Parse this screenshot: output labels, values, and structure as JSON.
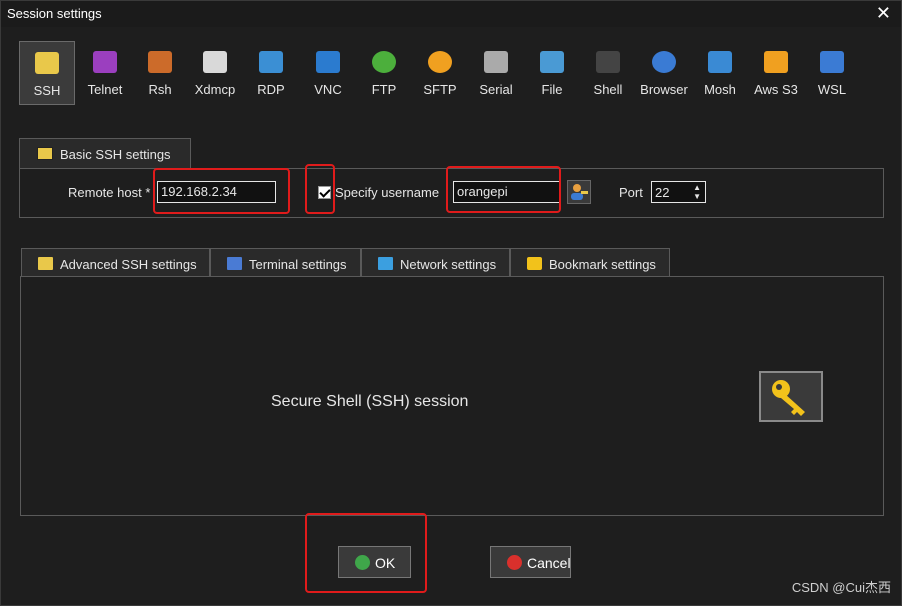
{
  "window": {
    "title": "Session settings",
    "close_glyph": "✕"
  },
  "protocols": [
    {
      "label": "SSH",
      "icon": "key-icon",
      "active": true
    },
    {
      "label": "Telnet",
      "icon": "telnet-icon",
      "active": false
    },
    {
      "label": "Rsh",
      "icon": "rsh-icon",
      "active": false
    },
    {
      "label": "Xdmcp",
      "icon": "xdmcp-icon",
      "active": false
    },
    {
      "label": "RDP",
      "icon": "rdp-icon",
      "active": false
    },
    {
      "label": "VNC",
      "icon": "vnc-icon",
      "active": false
    },
    {
      "label": "FTP",
      "icon": "ftp-icon",
      "active": false
    },
    {
      "label": "SFTP",
      "icon": "sftp-icon",
      "active": false
    },
    {
      "label": "Serial",
      "icon": "serial-icon",
      "active": false
    },
    {
      "label": "File",
      "icon": "file-icon",
      "active": false
    },
    {
      "label": "Shell",
      "icon": "shell-icon",
      "active": false
    },
    {
      "label": "Browser",
      "icon": "browser-icon",
      "active": false
    },
    {
      "label": "Mosh",
      "icon": "mosh-icon",
      "active": false
    },
    {
      "label": "Aws S3",
      "icon": "aws-s3-icon",
      "active": false
    },
    {
      "label": "WSL",
      "icon": "wsl-icon",
      "active": false
    }
  ],
  "basic": {
    "tab_label": "Basic SSH settings",
    "remote_host_label": "Remote host *",
    "remote_host_value": "192.168.2.34",
    "specify_username_label": "Specify username",
    "specify_username_checked": true,
    "username_value": "orangepi",
    "port_label": "Port",
    "port_value": "22"
  },
  "subtabs": [
    {
      "label": "Advanced SSH settings",
      "icon": "wrench-icon"
    },
    {
      "label": "Terminal settings",
      "icon": "terminal-icon"
    },
    {
      "label": "Network settings",
      "icon": "network-icon"
    },
    {
      "label": "Bookmark settings",
      "icon": "star-icon"
    }
  ],
  "panel": {
    "description": "Secure Shell (SSH) session"
  },
  "buttons": {
    "ok": "OK",
    "cancel": "Cancel"
  },
  "watermark": "CSDN @Cui杰西",
  "colors": {
    "background": "#1e1e1e",
    "highlight": "#e01b1b",
    "ok_icon": "#3fa64a",
    "cancel_icon": "#d9302c",
    "key_icon": "#f2c21b"
  }
}
